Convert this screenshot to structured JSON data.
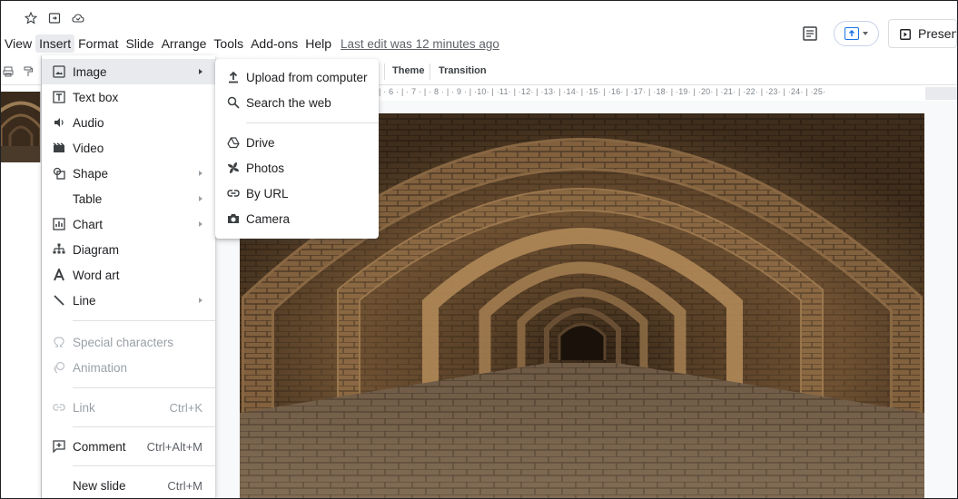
{
  "menubar": {
    "items": [
      "View",
      "Insert",
      "Format",
      "Slide",
      "Arrange",
      "Tools",
      "Add-ons",
      "Help"
    ],
    "active": "Insert",
    "last_edit": "Last edit was 12 minutes ago"
  },
  "header": {
    "present_label": "Presen"
  },
  "toolbar": {
    "theme_label": "Theme",
    "transition_label": "Transition"
  },
  "ruler": {
    "text": "| · 6 · | · 7 · | · 8 · | · 9 · | ·10· | ·11· | ·12· | ·13· | ·14· | ·15· | ·16· | ·17· | ·18· | ·19· | ·20· | ·21· | ·22· | ·23· | ·24· | ·25·"
  },
  "insert_menu": {
    "items": [
      {
        "label": "Image",
        "icon": "image-icon",
        "submenu": true
      },
      {
        "label": "Text box",
        "icon": "text-box-icon",
        "submenu": false
      },
      {
        "label": "Audio",
        "icon": "audio-icon",
        "submenu": false
      },
      {
        "label": "Video",
        "icon": "video-icon",
        "submenu": false
      },
      {
        "label": "Shape",
        "icon": "shape-icon",
        "submenu": true
      },
      {
        "label": "Table",
        "icon": "",
        "submenu": true
      },
      {
        "label": "Chart",
        "icon": "chart-icon",
        "submenu": true
      },
      {
        "label": "Diagram",
        "icon": "diagram-icon",
        "submenu": false
      },
      {
        "label": "Word art",
        "icon": "word-art-icon",
        "submenu": false
      },
      {
        "label": "Line",
        "icon": "line-icon",
        "submenu": true
      },
      {
        "label": "Special characters",
        "icon": "omega-icon",
        "submenu": false,
        "disabled": true
      },
      {
        "label": "Animation",
        "icon": "animation-icon",
        "submenu": false,
        "disabled": true
      },
      {
        "label": "Link",
        "icon": "link-icon",
        "shortcut": "Ctrl+K",
        "disabled": true
      },
      {
        "label": "Comment",
        "icon": "comment-icon",
        "shortcut": "Ctrl+Alt+M"
      },
      {
        "label": "New slide",
        "icon": "",
        "shortcut": "Ctrl+M"
      }
    ]
  },
  "image_submenu": {
    "items": [
      {
        "label": "Upload from computer",
        "icon": "upload-icon"
      },
      {
        "label": "Search the web",
        "icon": "search-icon"
      },
      {
        "label": "Drive",
        "icon": "drive-icon"
      },
      {
        "label": "Photos",
        "icon": "photos-icon"
      },
      {
        "label": "By URL",
        "icon": "link-icon"
      },
      {
        "label": "Camera",
        "icon": "camera-icon"
      }
    ]
  },
  "colors": {
    "menu_highlight": "#e8eaed",
    "accent": "#1a73e8",
    "disabled_text": "#9aa0a6"
  }
}
